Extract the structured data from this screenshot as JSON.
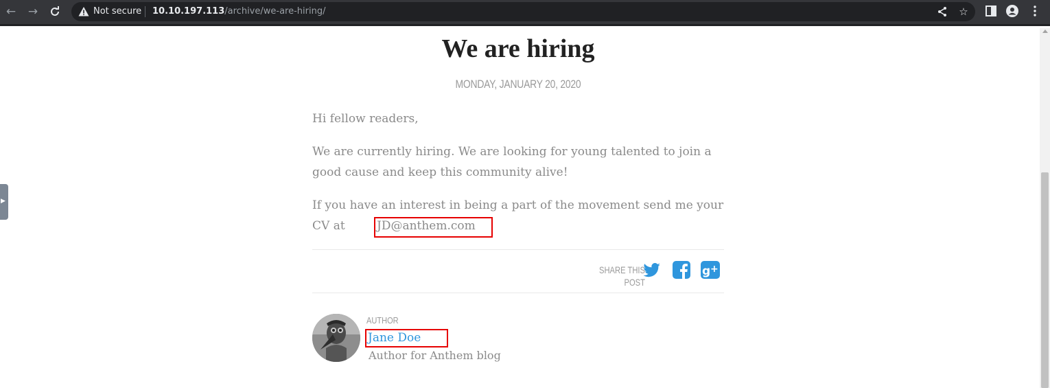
{
  "browser": {
    "security_label": "Not secure",
    "url_host": "10.10.197.113",
    "url_path": "/archive/we-are-hiring/",
    "icons": [
      "back-arrow-icon",
      "forward-arrow-icon",
      "reload-icon",
      "warning-icon",
      "share-icon",
      "star-icon",
      "side-panel-icon",
      "profile-icon",
      "menu-icon"
    ]
  },
  "article": {
    "title": "We are hiring",
    "date": "MONDAY, JANUARY 20, 2020",
    "p1": "Hi fellow readers,",
    "p2": "We are currently hiring. We are looking for young talented to join a good cause and keep this community alive!",
    "p3_before": "If you have an interest in being a part of the movement send me your CV at ",
    "email": "JD@anthem.com"
  },
  "share": {
    "label": "SHARE THIS POST",
    "icons": [
      "twitter-icon",
      "facebook-icon",
      "google-plus-icon"
    ],
    "color": "#2f96dd"
  },
  "author": {
    "label": "AUTHOR",
    "name": "Jane Doe",
    "bio": "Author for Anthem blog"
  },
  "colors": {
    "highlight_box": "#e60000",
    "link": "#2f96dd",
    "body_text": "#8a8a8a"
  }
}
